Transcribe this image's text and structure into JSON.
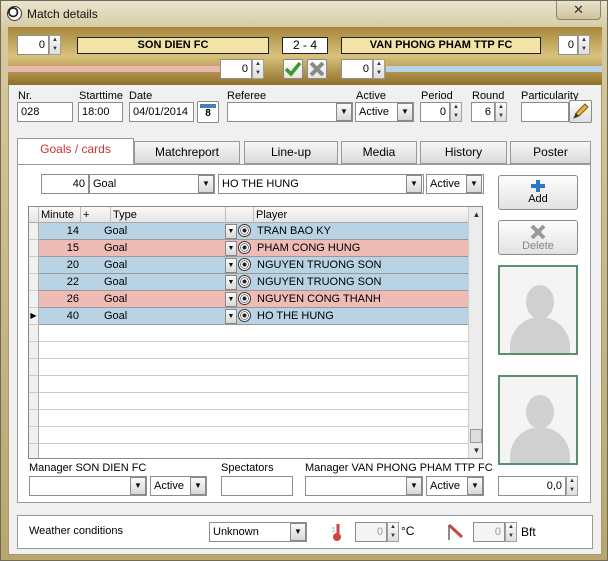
{
  "window": {
    "title": "Match details",
    "close_label": "✕"
  },
  "header": {
    "home_extra": "0",
    "home_team": "SON DIEN FC",
    "score": "2  - 4",
    "away_team": "VAN PHONG PHAM TTP FC",
    "away_extra": "0",
    "home_sub": "0",
    "away_sub": "0"
  },
  "info": {
    "nr_label": "Nr.",
    "nr_value": "028",
    "starttime_label": "Starttime",
    "starttime_value": "18:00",
    "date_label": "Date",
    "date_value": "04/01/2014",
    "calendar_num": "8",
    "referee_label": "Referee",
    "referee_value": "",
    "active_label": "Active",
    "active_value": "Active",
    "period_label": "Period",
    "period_value": "0",
    "round_label": "Round",
    "round_value": "6",
    "particularity_label": "Particularity",
    "particularity_value": ""
  },
  "tabs": [
    "Goals / cards",
    "Matchreport",
    "Line-up",
    "Media",
    "History",
    "Poster"
  ],
  "entry": {
    "minute": "40",
    "type": "Goal",
    "player": "HO THE HUNG",
    "status": "Active"
  },
  "grid": {
    "headers": {
      "minute": "Minute",
      "plus": "+",
      "type": "Type",
      "player": "Player"
    },
    "rows": [
      {
        "minute": "14",
        "type": "Goal",
        "player": "TRAN BAO KY",
        "color": "blue"
      },
      {
        "minute": "15",
        "type": "Goal",
        "player": "PHAM CONG HUNG",
        "color": "pink"
      },
      {
        "minute": "20",
        "type": "Goal",
        "player": "NGUYEN TRUONG SON",
        "color": "blue"
      },
      {
        "minute": "22",
        "type": "Goal",
        "player": "NGUYEN TRUONG SON",
        "color": "blue"
      },
      {
        "minute": "26",
        "type": "Goal",
        "player": "NGUYEN CONG THANH",
        "color": "pink"
      },
      {
        "minute": "40",
        "type": "Goal",
        "player": "HO THE HUNG",
        "color": "blue"
      }
    ],
    "current_row_marker": "▶"
  },
  "side": {
    "add_label": "Add",
    "delete_label": "Delete",
    "rating_value": "0,0"
  },
  "managers": {
    "home_label": "Manager SON DIEN FC",
    "home_value": "",
    "home_status": "Active",
    "spectators_label": "Spectators",
    "spectators_value": "",
    "away_label": "Manager VAN PHONG PHAM TTP FC",
    "away_value": "",
    "away_status": "Active"
  },
  "weather": {
    "label": "Weather conditions",
    "condition": "Unknown",
    "temp_value": "0",
    "temp_unit": "°C",
    "wind_value": "0",
    "wind_unit": "Bft"
  },
  "colors": {
    "row_blue": "#b9d3e4",
    "row_pink": "#eebcb4",
    "team_box": "#f2e3a8",
    "active_tab_text": "#cc3333"
  }
}
